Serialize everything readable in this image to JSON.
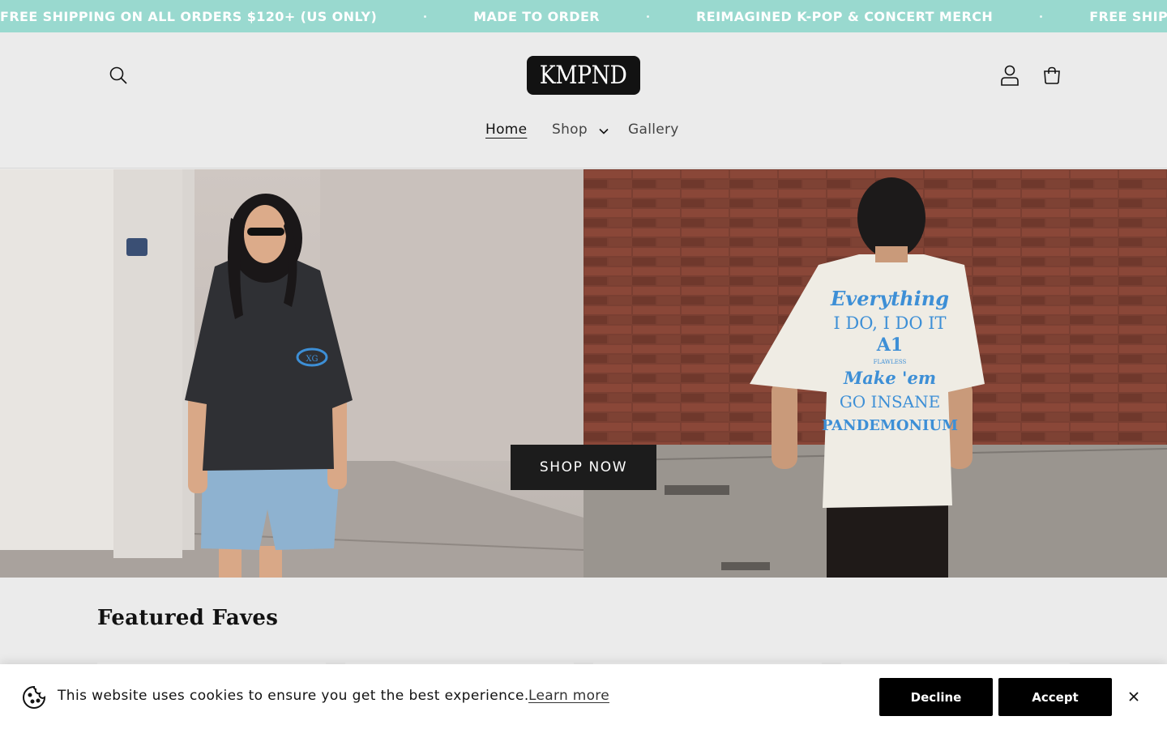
{
  "announcement": {
    "messages": [
      "FREE SHIPPING ON ALL ORDERS $120+ (US ONLY)",
      "MADE TO ORDER",
      "REIMAGINED K-POP & CONCERT MERCH",
      "FREE SHIPPING O"
    ],
    "background": "#99d9cf",
    "text_color": "#ffffff"
  },
  "header": {
    "logo_text": "KMPND",
    "icons": {
      "search": "search-icon",
      "account": "user-icon",
      "cart": "cart-icon"
    }
  },
  "nav": {
    "items": [
      {
        "label": "Home",
        "active": true
      },
      {
        "label": "Shop",
        "has_dropdown": true
      },
      {
        "label": "Gallery"
      }
    ]
  },
  "hero": {
    "button_label": "SHOP NOW",
    "left_shirt_print": "XG",
    "right_shirt_print": {
      "lines": [
        "Everything",
        "I DO, I DO IT",
        "A1",
        "FLAWLESS",
        "Make 'em",
        "GO INSANE",
        "PANDEMONIUM"
      ]
    },
    "print_color": "#3d8fd6"
  },
  "featured": {
    "title": "Featured Faves"
  },
  "cookie": {
    "message": "This website uses cookies to ensure you get the best experience.",
    "learn_more": "Learn more",
    "decline": "Decline",
    "accept": "Accept",
    "icons": {
      "cookie": "cookie-icon",
      "close": "close-icon"
    }
  }
}
